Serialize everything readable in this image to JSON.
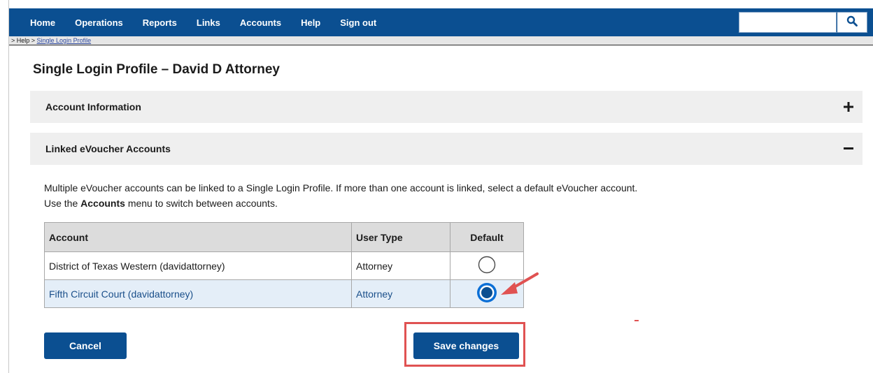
{
  "nav": {
    "items": [
      "Home",
      "Operations",
      "Reports",
      "Links",
      "Accounts",
      "Help",
      "Sign out"
    ],
    "search": {
      "value": "",
      "icon": "search-icon"
    },
    "color": "#0b4f91"
  },
  "breadcrumb": {
    "prefix": "> Help > ",
    "current": "Single Login Profile"
  },
  "page": {
    "title": "Single Login Profile – David D Attorney"
  },
  "sections": {
    "account_info": {
      "title": "Account Information",
      "icon": "plus-icon",
      "expanded": false
    },
    "linked": {
      "title": "Linked eVoucher Accounts",
      "icon": "minus-icon",
      "expanded": true
    }
  },
  "description": {
    "line1": "Multiple eVoucher accounts can be linked to a Single Login Profile. If more than one account is linked, select a default eVoucher account.",
    "line2_pre": "Use the ",
    "line2_bold": "Accounts",
    "line2_post": " menu to switch between accounts."
  },
  "table": {
    "headers": {
      "account": "Account",
      "user_type": "User Type",
      "default": "Default"
    },
    "rows": [
      {
        "account": "District of Texas Western (davidattorney)",
        "user_type": "Attorney",
        "default_selected": false
      },
      {
        "account": "Fifth Circuit Court (davidattorney)",
        "user_type": "Attorney",
        "default_selected": true
      }
    ]
  },
  "buttons": {
    "cancel": "Cancel",
    "save": "Save changes"
  },
  "colors": {
    "primary": "#0b4f91",
    "annotation": "#e05252",
    "selected_row": "#e4eef8"
  }
}
